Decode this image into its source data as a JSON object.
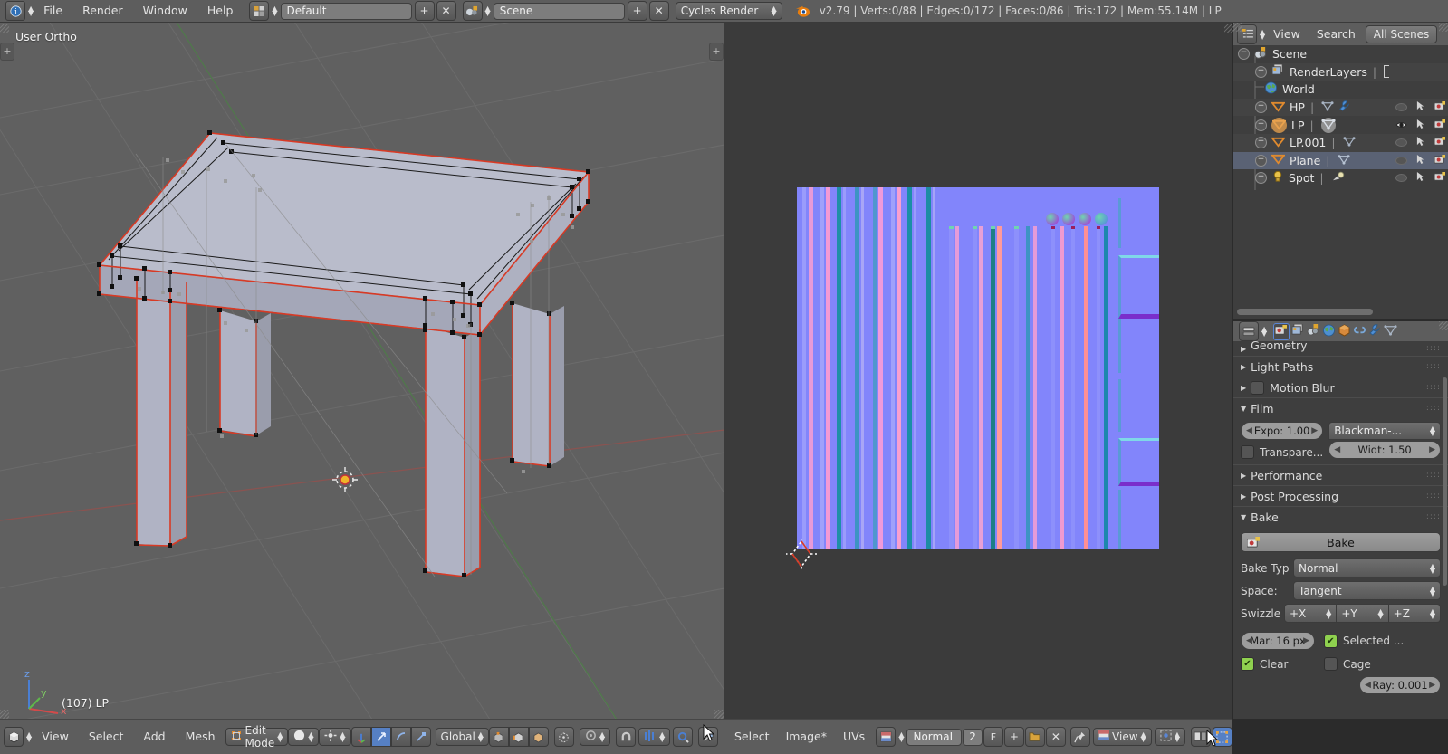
{
  "topbar": {
    "app_icon": "blender-info-icon",
    "menus": [
      "File",
      "Render",
      "Window",
      "Help"
    ],
    "screen_layout": {
      "icon": "screen-layout-icon",
      "value": "Default",
      "new_btn": "+",
      "delete_btn": "✕"
    },
    "scene": {
      "icon": "scene-icon",
      "value": "Scene",
      "new_btn": "+",
      "delete_btn": "✕"
    },
    "engine": {
      "value": "Cycles Render"
    },
    "stats": "v2.79 | Verts:0/88 | Edges:0/172 | Faces:0/86 | Tris:172 | Mem:55.14M | LP"
  },
  "viewport": {
    "view_label": "User Ortho",
    "object_label": "(107) LP",
    "axis_gizmo": {
      "z": "z",
      "y": "y",
      "x": "x"
    },
    "header": {
      "editor_icon": "editor-type-3dview-icon",
      "menus": [
        "View",
        "Select",
        "Add",
        "Mesh"
      ],
      "mode": {
        "icon": "edit-mode-icon",
        "value": "Edit Mode"
      },
      "shading": {
        "icon": "shading-solid-icon"
      },
      "pivot": {
        "icon": "pivot-median-point-icon"
      },
      "manipulators": [
        "translate-manipulator-icon",
        "rotate-manipulator-icon",
        "scale-manipulator-icon"
      ],
      "manipulator_toggle": "manipulator-toggle-icon",
      "orientation": "Global",
      "select_modes": [
        "vertex-select-icon",
        "edge-select-icon",
        "face-select-icon"
      ],
      "occlude": "occlude-geometry-icon",
      "proportional": {
        "icon": "proportional-edit-off-icon"
      },
      "snap_magnet": "snap-magnet-icon",
      "snap_element": "snap-element-increment-icon",
      "snap_target": "snap-target-closest-icon",
      "snap_extra": "snap-peel-object-icon",
      "render_btn": "render-active-view-icon"
    }
  },
  "uv_editor": {
    "header": {
      "menus": [
        "Select",
        "Image*",
        "UVs"
      ],
      "image_icon": "image-datablock-icon",
      "image_name": "NormaL",
      "users_count": "2",
      "fake_user": "F",
      "new_btn": "+",
      "open_btn": "open-image-icon",
      "unlink_btn": "✕",
      "pin_btn": "pin-icon",
      "view_mode": {
        "icon": "image-view-icon",
        "value": "View"
      },
      "pivot": "pivot-bounding-box-icon",
      "uv_sync": "uv-sync-selection-icon",
      "snap_uv": "uv-snap-icon"
    },
    "image": {
      "name": "NormaL",
      "base_color": "#8285fb",
      "stripe_pink": "#f49ad2",
      "stripe_teal": "#1e8fa8",
      "stripe_salmon": "#ff9a9a",
      "stripe_purple": "#7a2ecb",
      "stripe_cyan": "#7fd8e8"
    }
  },
  "outliner": {
    "header": {
      "display_mode_icon": "outliner-display-mode-icon",
      "menus": [
        "View",
        "Search"
      ],
      "scope": "All Scenes"
    },
    "rows": [
      {
        "label": "Scene",
        "icon": "scene-icon",
        "indent": 0,
        "expanded": true,
        "selected": false,
        "restrict": false
      },
      {
        "label": "RenderLayers",
        "icon": "renderlayers-icon",
        "indent": 1,
        "expanded": false,
        "selected": false,
        "restrict": false
      },
      {
        "label": "World",
        "icon": "world-icon",
        "indent": 1,
        "expanded": false,
        "selected": false,
        "restrict": false
      },
      {
        "label": "HP",
        "icon": "mesh-object-icon",
        "datatype": "mesh-data-icon",
        "extra": "modifier-wrench-icon",
        "indent": 1,
        "expanded": false,
        "selected": false,
        "restrict": true,
        "visible": false
      },
      {
        "label": "LP",
        "icon": "mesh-object-icon",
        "datatype": "mesh-data-icon",
        "indent": 1,
        "expanded": false,
        "selected": true,
        "active": true,
        "restrict": true,
        "visible": true
      },
      {
        "label": "LP.001",
        "icon": "mesh-object-icon",
        "datatype": "mesh-data-icon",
        "indent": 1,
        "expanded": false,
        "selected": false,
        "restrict": true,
        "visible": false
      },
      {
        "label": "Plane",
        "icon": "mesh-object-icon",
        "datatype": "mesh-data-icon",
        "indent": 1,
        "expanded": false,
        "selected": true,
        "restrict": true,
        "visible": false
      },
      {
        "label": "Spot",
        "icon": "lamp-object-icon",
        "datatype": "lamp-data-icon",
        "indent": 1,
        "expanded": false,
        "selected": false,
        "restrict": true,
        "visible": false
      }
    ]
  },
  "properties": {
    "tabs": [
      "render-tab-icon",
      "renderlayers-tab-icon",
      "scene-tab-icon",
      "world-tab-icon",
      "object-tab-icon",
      "constraints-tab-icon",
      "modifiers-tab-icon",
      "data-tab-icon"
    ],
    "active_tab": "render-tab-icon",
    "panels": [
      {
        "name": "Geometry",
        "open": false,
        "clipped": true
      },
      {
        "name": "Light Paths",
        "open": false
      },
      {
        "name": "Motion Blur",
        "open": false,
        "checkbox": false
      },
      {
        "name": "Film",
        "open": true
      },
      {
        "name": "Performance",
        "open": false
      },
      {
        "name": "Post Processing",
        "open": false
      },
      {
        "name": "Bake",
        "open": true
      }
    ],
    "film": {
      "exposure": {
        "label": "Expo: 1.00"
      },
      "filter_type": "Blackman-...",
      "filter_width": {
        "label": "Widt: 1.50"
      },
      "transparent": {
        "label": "Transpare...",
        "checked": false
      }
    },
    "bake": {
      "bake_button": {
        "label": "Bake",
        "icon": "bake-render-icon"
      },
      "bake_type": {
        "label": "Bake Typ",
        "value": "Normal"
      },
      "space": {
        "label": "Space:",
        "value": "Tangent"
      },
      "swizzle": {
        "label": "Swizzle",
        "x": "+X",
        "y": "+Y",
        "z": "+Z"
      },
      "margin": {
        "label": "Mar: 16 px"
      },
      "selected_to_active": {
        "label": "Selected ...",
        "checked": true
      },
      "clear": {
        "label": "Clear",
        "checked": true
      },
      "cage": {
        "label": "Cage",
        "checked": false
      },
      "ray_distance": {
        "label": "Ray: 0.001"
      }
    }
  }
}
